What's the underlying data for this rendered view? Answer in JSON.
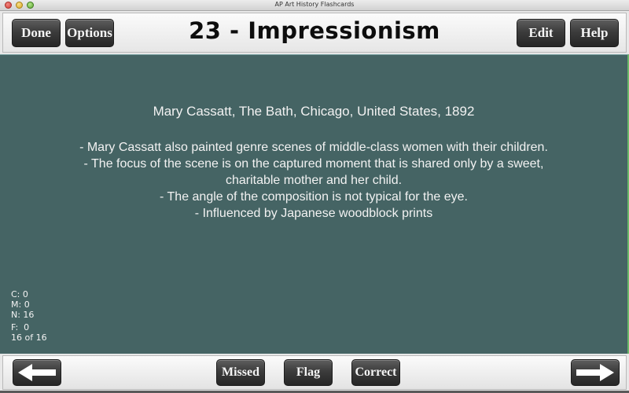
{
  "window": {
    "title": "AP Art History Flashcards",
    "controls": [
      "close",
      "minimize",
      "zoom"
    ]
  },
  "toolbar": {
    "done_label": "Done",
    "options_label": "Options",
    "title": "23 - Impressionism",
    "edit_label": "Edit",
    "help_label": "Help"
  },
  "card": {
    "heading": "Mary Cassatt, The Bath, Chicago, United States, 1892",
    "lines": [
      "- Mary Cassatt also painted genre scenes of middle-class women with their children.",
      "- The focus of the scene is on the captured moment that is shared only by a sweet, charitable mother and her child.",
      "- The angle of the composition is not typical for the eye.",
      "- Influenced by Japanese woodblock prints"
    ]
  },
  "stats": {
    "correct": "C: 0",
    "missed": "M: 0",
    "new": "N: 16",
    "flagged": "F:  0",
    "position": "16 of 16"
  },
  "bottombar": {
    "prev_icon": "arrow-left-icon",
    "missed_label": "Missed",
    "flag_label": "Flag",
    "correct_label": "Correct",
    "next_icon": "arrow-right-icon"
  },
  "colors": {
    "card_background": "#456464",
    "button_background": "#333333",
    "text_light": "#f2f2f2"
  }
}
